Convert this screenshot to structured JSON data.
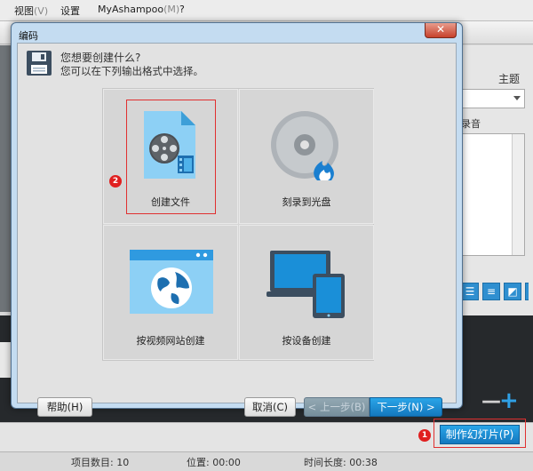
{
  "menu": {
    "items": [
      {
        "label": "视图",
        "hotkey": "(V)"
      },
      {
        "label": "设置",
        "hotkey": ""
      },
      {
        "label": "MyAshampoo",
        "hotkey": "(M)"
      },
      {
        "label": "?",
        "hotkey": ""
      }
    ]
  },
  "right_panel": {
    "theme_label": "主题",
    "music_label": "录音"
  },
  "dialog": {
    "title": "编码",
    "heading": "您想要创建什么?",
    "subheading": "您可以在下列输出格式中选择。",
    "options": [
      {
        "label": "创建文件",
        "icon": "film-file-icon",
        "selected": true
      },
      {
        "label": "刻录到光盘",
        "icon": "disc-burn-icon",
        "selected": false
      },
      {
        "label": "按视频网站创建",
        "icon": "web-globe-icon",
        "selected": false
      },
      {
        "label": "按设备创建",
        "icon": "devices-icon",
        "selected": false
      }
    ],
    "buttons": {
      "help": "帮助(H)",
      "cancel": "取消(C)",
      "prev": "< 上一步(B)",
      "next": "下一步(N) >"
    },
    "close_glyph": "✕"
  },
  "action_bar": {
    "make_slideshow": "制作幻灯片(P)"
  },
  "markers": {
    "one": "1",
    "two": "2"
  },
  "status": {
    "item_count": "项目数目: 10",
    "position": "位置: 00:00",
    "duration": "时间长度: 00:38"
  },
  "colors": {
    "accent": "#1a8fd8",
    "annotation": "#e02020",
    "dialog_frame": "#c4dcf1"
  }
}
